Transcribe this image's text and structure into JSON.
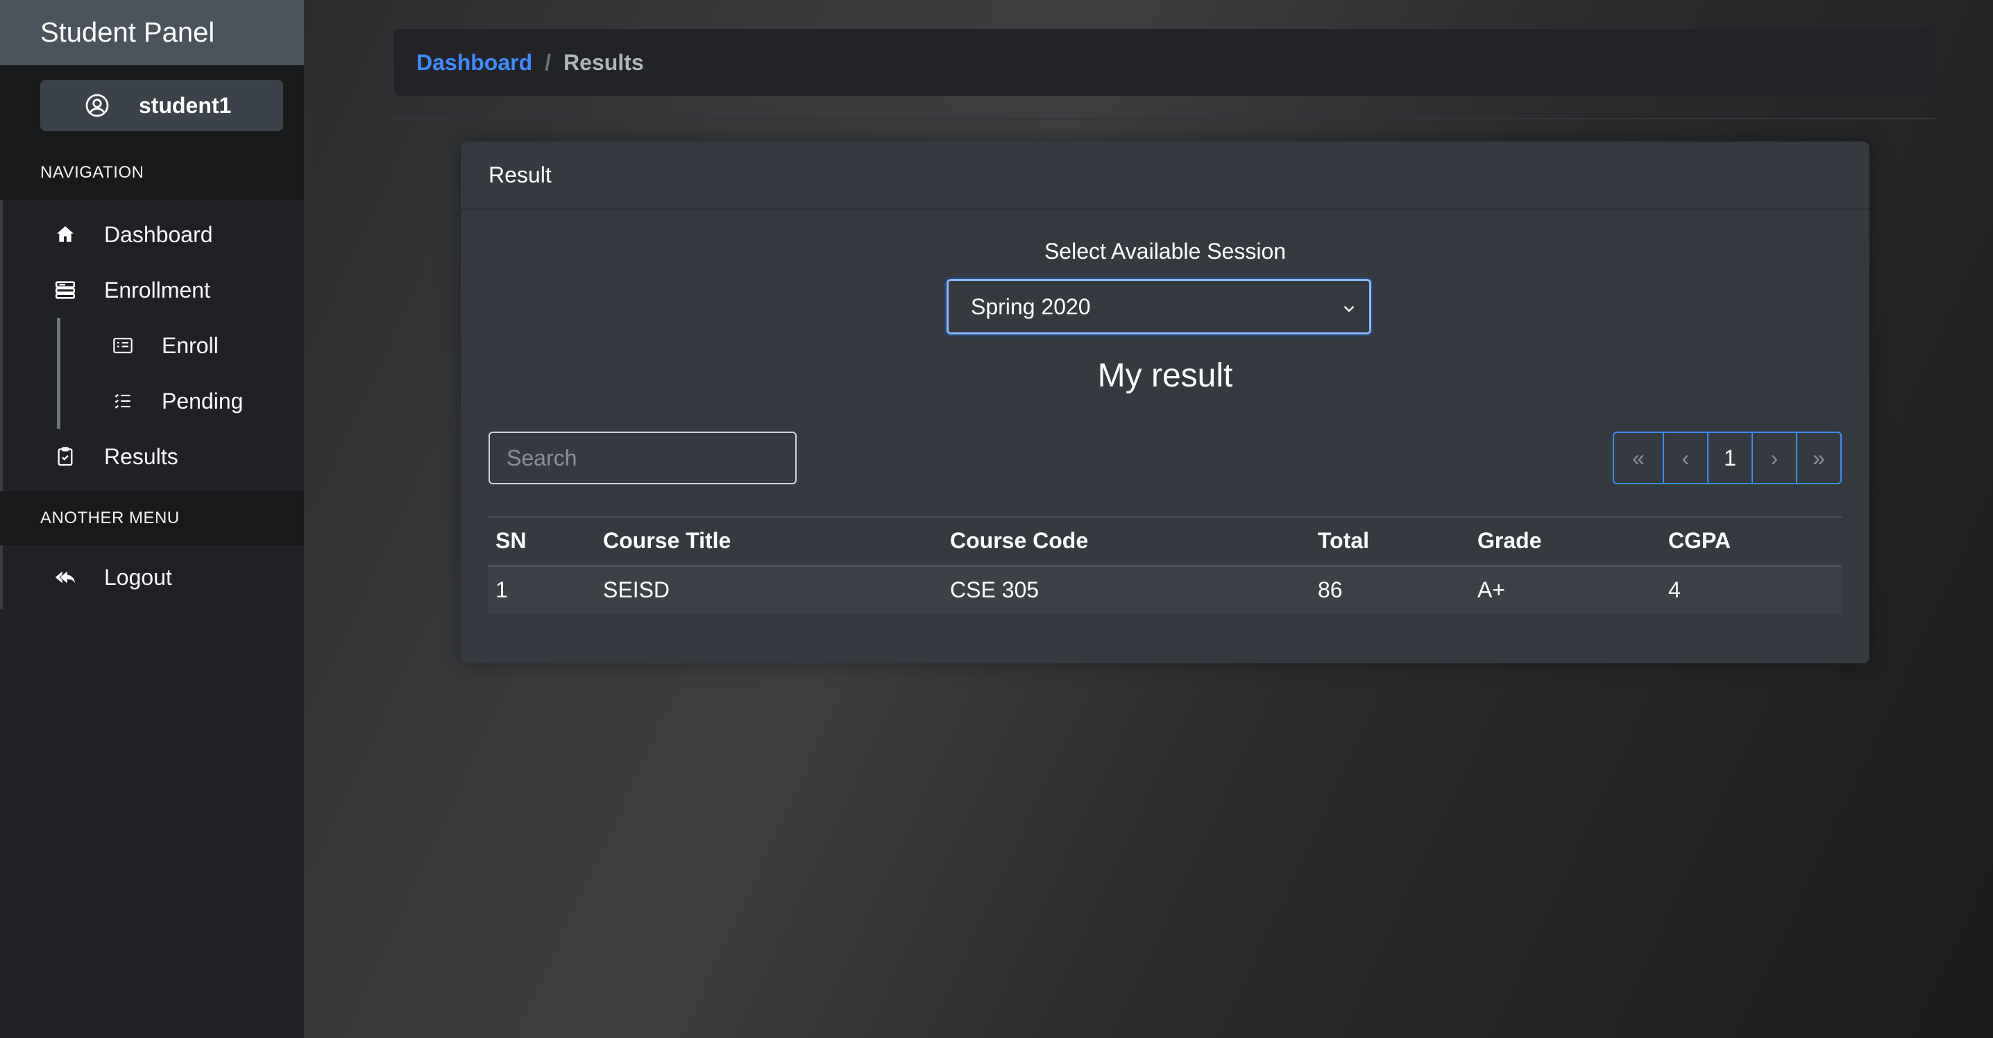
{
  "sidebar": {
    "brand": "Student Panel",
    "user": "student1",
    "section_navigation": "NAVIGATION",
    "section_another": "ANOTHER MENU",
    "items": {
      "dashboard": "Dashboard",
      "enrollment": "Enrollment",
      "enroll": "Enroll",
      "pending": "Pending",
      "results": "Results",
      "logout": "Logout"
    }
  },
  "breadcrumb": {
    "link": "Dashboard",
    "separator": "/",
    "current": "Results"
  },
  "card": {
    "title": "Result",
    "session_label": "Select Available Session",
    "session_selected": "Spring 2020",
    "heading": "My result",
    "search_placeholder": "Search",
    "pagination": {
      "first": "«",
      "prev": "‹",
      "page": "1",
      "next": "›",
      "last": "»"
    },
    "table": {
      "headers": [
        "SN",
        "Course Title",
        "Course Code",
        "Total",
        "Grade",
        "CGPA"
      ],
      "rows": [
        [
          "1",
          "SEISD",
          "CSE 305",
          "86",
          "A+",
          "4"
        ]
      ]
    }
  },
  "colors": {
    "accent": "#3d8bfd",
    "sidebar_bg": "#1f2124",
    "brand_bg": "#4b545c",
    "card_bg": "#343a40"
  }
}
